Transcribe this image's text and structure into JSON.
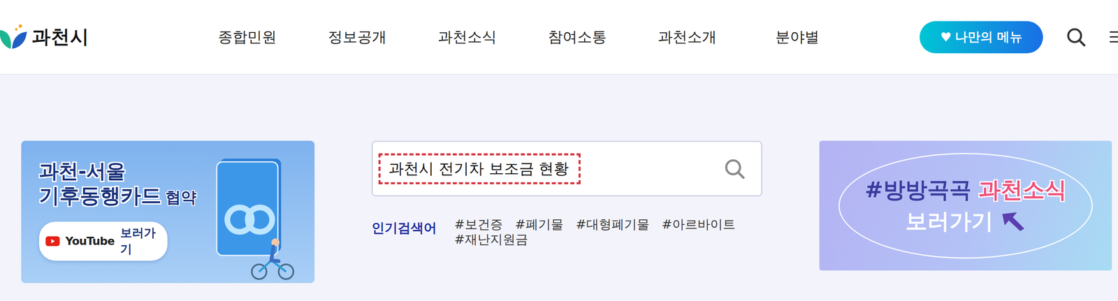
{
  "header": {
    "logo": "과천시",
    "nav": [
      "종합민원",
      "정보공개",
      "과천소식",
      "참여소통",
      "과천소개",
      "분야별"
    ],
    "my_menu": {
      "icon": "♥",
      "label": "나만의 메뉴"
    }
  },
  "left_banner": {
    "title": "과천-서울",
    "subtitle": "기후동행카드",
    "subtitle_tag": "협약",
    "button": {
      "brand": "YouTube",
      "label": "보러가기"
    }
  },
  "search": {
    "value": "과천시 전기차 보조금 현황"
  },
  "popular": {
    "label": "인기검색어",
    "keywords": [
      "#보건증",
      "#폐기물",
      "#대형폐기물",
      "#아르바이트",
      "#재난지원금"
    ]
  },
  "right_banner": {
    "line1": "#방방곡곡",
    "line2": "과천소식",
    "line3": "보러가기"
  }
}
